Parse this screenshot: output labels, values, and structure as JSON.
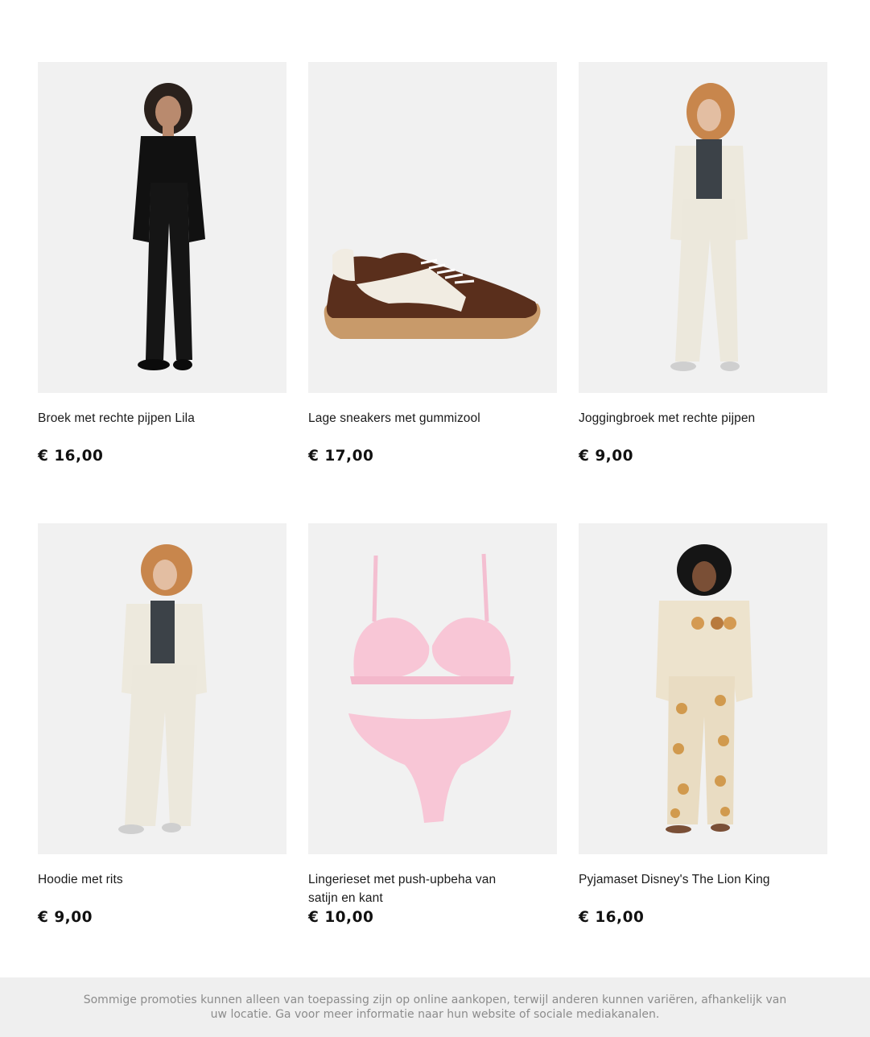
{
  "products": [
    {
      "title": "Broek met rechte pijpen Lila",
      "price": "€ 16,00",
      "image_icon": "model-black-suit-image"
    },
    {
      "title": "Lage sneakers met gummizool",
      "price": "€ 17,00",
      "image_icon": "brown-sneaker-image"
    },
    {
      "title": "Joggingbroek met rechte pijpen",
      "price": "€ 9,00",
      "image_icon": "model-cream-joggers-image"
    },
    {
      "title": "Hoodie met rits",
      "price": "€ 9,00",
      "image_icon": "model-cream-hoodie-image"
    },
    {
      "title": "Lingerieset met push-upbeha van satijn en kant",
      "price": "€ 10,00",
      "image_icon": "pink-lingerie-set-image"
    },
    {
      "title": "Pyjamaset Disney's The Lion King",
      "price": "€ 16,00",
      "image_icon": "model-lion-king-pyjama-image"
    }
  ],
  "footer": {
    "disclaimer": "Sommige promoties kunnen alleen van toepassing zijn op online aankopen, terwijl anderen kunnen variëren, afhankelijk van uw locatie. Ga voor meer informatie naar hun website of sociale mediakanalen."
  },
  "colors": {
    "image_bg": "#f1f1f1",
    "footer_bg": "#efefef",
    "footer_text": "#8c8c8c"
  }
}
